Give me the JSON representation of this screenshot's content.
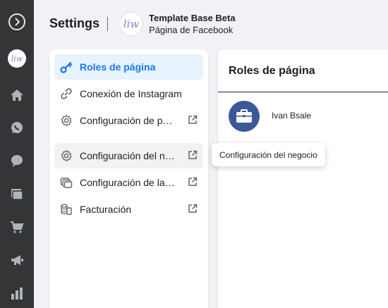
{
  "header": {
    "title": "Settings",
    "avatar_text": "liw",
    "page_name": "Template Base Beta",
    "page_subtitle": "Página de Facebook"
  },
  "rail": {
    "items": [
      {
        "icon": "arrow-circle-icon"
      },
      {
        "icon": "page-avatar-icon",
        "text": "liw"
      },
      {
        "icon": "home-icon"
      },
      {
        "icon": "whatsapp-icon"
      },
      {
        "icon": "messenger-icon"
      },
      {
        "icon": "pages-icon"
      },
      {
        "icon": "shop-icon"
      },
      {
        "icon": "megaphone-icon"
      },
      {
        "icon": "insights-icon"
      }
    ]
  },
  "menu": {
    "items": [
      {
        "label": "Roles de página",
        "icon": "key-icon",
        "active": true
      },
      {
        "label": "Conexión de Instagram",
        "icon": "link-icon"
      },
      {
        "label": "Configuración de página",
        "icon": "gear-icon",
        "external": true
      },
      {
        "label": "Configuración del negocio",
        "icon": "gear-icon",
        "external": true,
        "hovered": true
      },
      {
        "label": "Configuración de la cuenta",
        "icon": "accounts-icon",
        "external": true
      },
      {
        "label": "Facturación",
        "icon": "billing-icon",
        "external": true
      }
    ]
  },
  "content": {
    "title": "Roles de página",
    "people": [
      {
        "name": "Ivan Bsale",
        "avatar_icon": "briefcase-icon"
      }
    ]
  },
  "tooltip": {
    "text": "Configuración del negocio"
  },
  "colors": {
    "rail_bg": "#343536",
    "accent": "#1877f2",
    "active_bg": "#e7f3ff",
    "avatar_bg": "#3b5998"
  }
}
